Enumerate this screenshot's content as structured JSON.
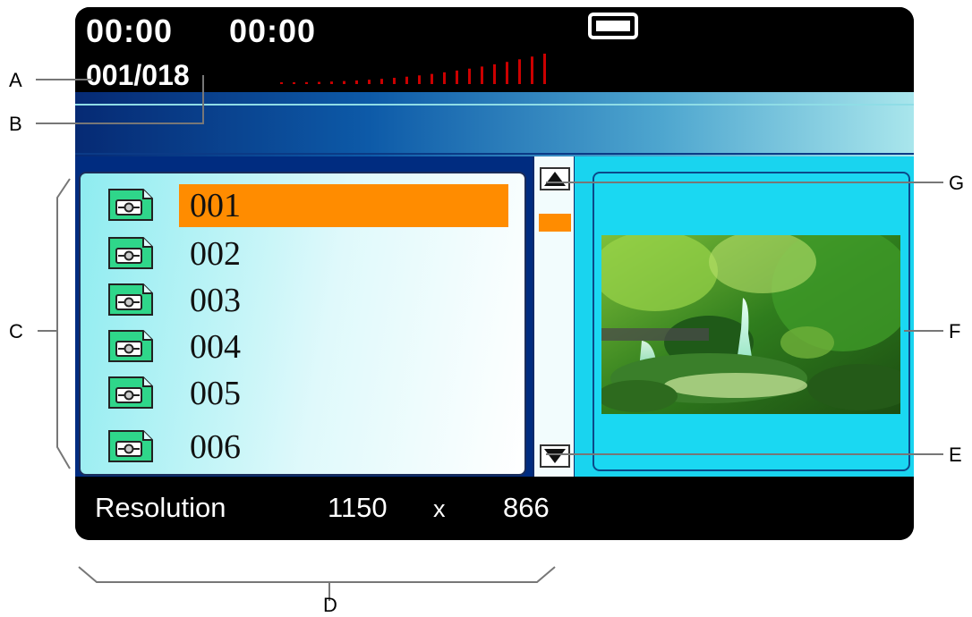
{
  "screen": {
    "time_elapsed": "00:00",
    "time_total": "00:00",
    "file_counter": "001/018",
    "battery_icon": "battery-icon",
    "volume_meter_icon": "signal-bars-icon"
  },
  "file_list": {
    "items": [
      {
        "label": "001",
        "selected": true
      },
      {
        "label": "002",
        "selected": false
      },
      {
        "label": "003",
        "selected": false
      },
      {
        "label": "004",
        "selected": false
      },
      {
        "label": "005",
        "selected": false
      },
      {
        "label": "006",
        "selected": false
      }
    ],
    "item_icon": "photo-file-icon"
  },
  "scrollbar": {
    "up_icon": "triangle-up-icon",
    "down_icon": "triangle-down-icon"
  },
  "status_bar": {
    "label": "Resolution",
    "width": "1150",
    "separator": "x",
    "height": "866"
  },
  "callouts": {
    "a": "A",
    "b": "B",
    "c": "C",
    "d": "D",
    "e": "E",
    "f": "F",
    "g": "G"
  },
  "colors": {
    "selection": "#ff8c00",
    "volume_meter": "#cc0000",
    "preview_background": "#19d4ef"
  }
}
